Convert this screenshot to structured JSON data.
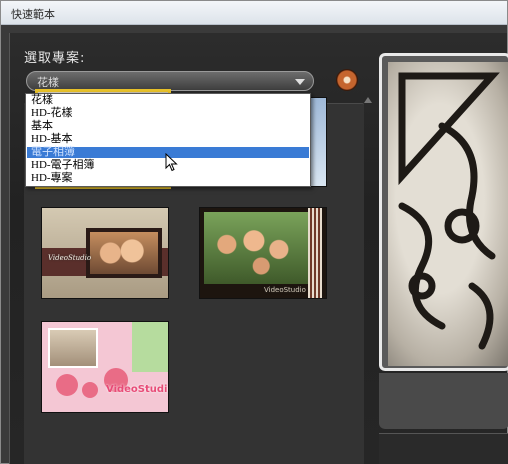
{
  "window": {
    "title": "快速範本"
  },
  "section": {
    "label": "選取專案:"
  },
  "combo": {
    "value": "花樣",
    "options": [
      "花樣",
      "HD-花樣",
      "基本",
      "HD-基本",
      "電子相簿",
      "HD-電子相簿",
      "HD-專案"
    ],
    "highlighted": "電子相簿"
  },
  "thumbnails": {
    "brand": "VideoStudio",
    "selected_index": 0
  },
  "colors": {
    "selection": "#e8c12a",
    "highlight": "#3a7bd5",
    "background": "#2c2c2c"
  }
}
